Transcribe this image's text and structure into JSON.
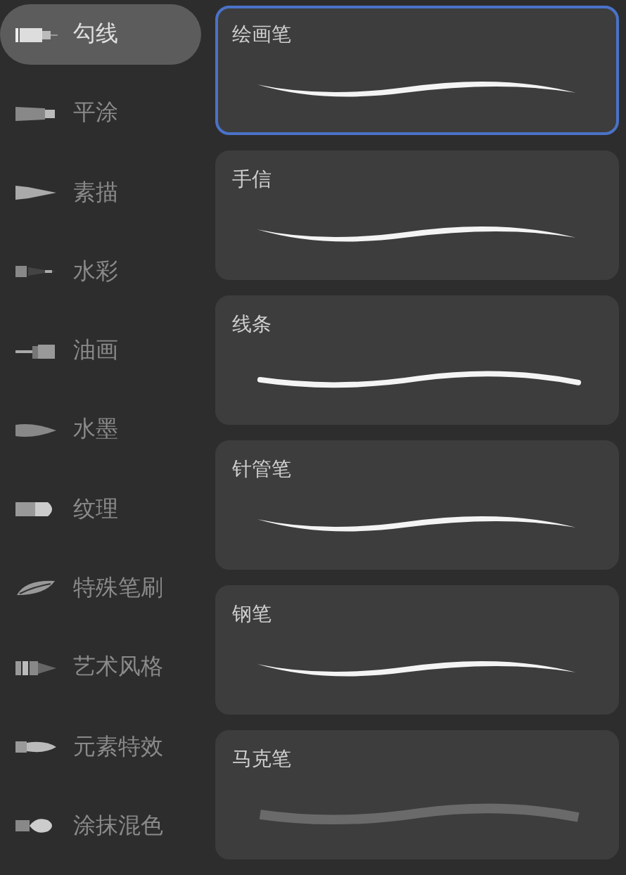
{
  "categories": [
    {
      "label": "勾线",
      "kind": "liner",
      "selected": true
    },
    {
      "label": "平涂",
      "kind": "flat",
      "selected": false
    },
    {
      "label": "素描",
      "kind": "cone",
      "selected": false
    },
    {
      "label": "水彩",
      "kind": "fine",
      "selected": false
    },
    {
      "label": "油画",
      "kind": "pin",
      "selected": false
    },
    {
      "label": "水墨",
      "kind": "blade",
      "selected": false
    },
    {
      "label": "纹理",
      "kind": "round",
      "selected": false
    },
    {
      "label": "特殊笔刷",
      "kind": "leaf",
      "selected": false
    },
    {
      "label": "艺术风格",
      "kind": "striped",
      "selected": false
    },
    {
      "label": "元素特效",
      "kind": "nib",
      "selected": false
    },
    {
      "label": "涂抹混色",
      "kind": "bulb",
      "selected": false
    }
  ],
  "brushes": [
    {
      "name": "绘画笔",
      "kind": "taper",
      "selected": true
    },
    {
      "name": "手信",
      "kind": "taper",
      "selected": false
    },
    {
      "name": "线条",
      "kind": "round",
      "selected": false
    },
    {
      "name": "针管笔",
      "kind": "taper",
      "selected": false
    },
    {
      "name": "钢笔",
      "kind": "taper",
      "selected": false
    },
    {
      "name": "马克笔",
      "kind": "marker",
      "selected": false
    }
  ]
}
